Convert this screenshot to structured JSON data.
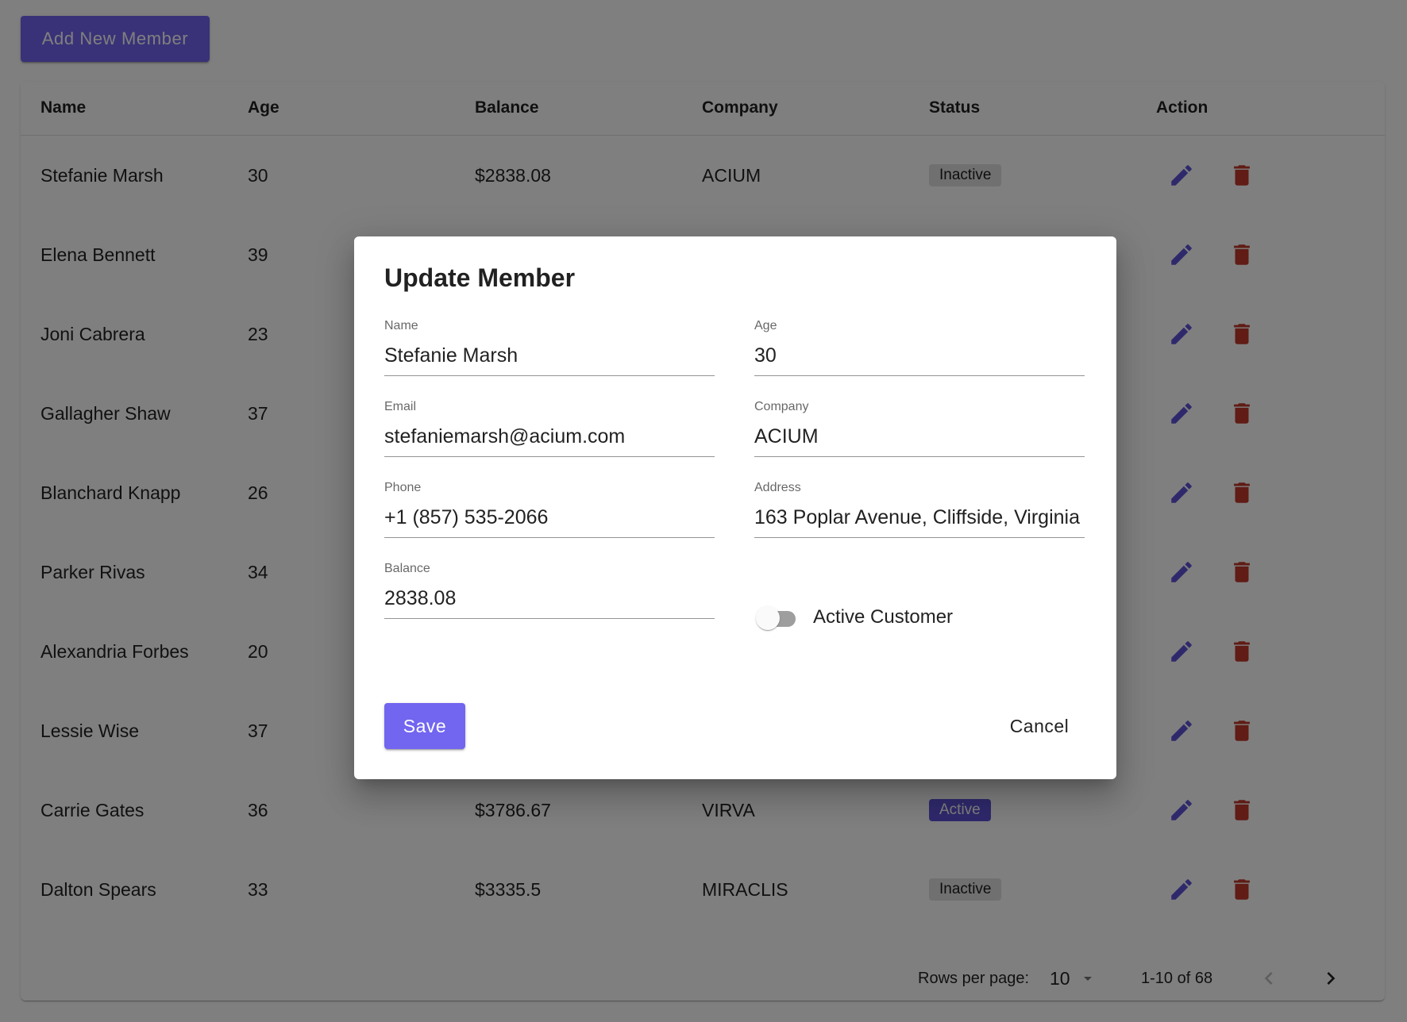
{
  "toolbar": {
    "add_label": "Add New Member"
  },
  "table": {
    "columns": [
      "Name",
      "Age",
      "Balance",
      "Company",
      "Status",
      "Action"
    ],
    "rows": [
      {
        "name": "Stefanie Marsh",
        "age": "30",
        "balance": "$2838.08",
        "company": "ACIUM",
        "status": "Inactive"
      },
      {
        "name": "Elena Bennett",
        "age": "39",
        "balance": "",
        "company": "",
        "status": ""
      },
      {
        "name": "Joni Cabrera",
        "age": "23",
        "balance": "",
        "company": "",
        "status": ""
      },
      {
        "name": "Gallagher Shaw",
        "age": "37",
        "balance": "",
        "company": "",
        "status": ""
      },
      {
        "name": "Blanchard Knapp",
        "age": "26",
        "balance": "",
        "company": "",
        "status": ""
      },
      {
        "name": "Parker Rivas",
        "age": "34",
        "balance": "",
        "company": "",
        "status": ""
      },
      {
        "name": "Alexandria Forbes",
        "age": "20",
        "balance": "",
        "company": "",
        "status": ""
      },
      {
        "name": "Lessie Wise",
        "age": "37",
        "balance": "",
        "company": "",
        "status": ""
      },
      {
        "name": "Carrie Gates",
        "age": "36",
        "balance": "$3786.67",
        "company": "VIRVA",
        "status": "Active"
      },
      {
        "name": "Dalton Spears",
        "age": "33",
        "balance": "$3335.5",
        "company": "MIRACLIS",
        "status": "Inactive"
      }
    ]
  },
  "pagination": {
    "rows_label": "Rows per page:",
    "rows_value": "10",
    "range": "1-10 of 68"
  },
  "dialog": {
    "title": "Update Member",
    "fields": {
      "name": {
        "label": "Name",
        "value": "Stefanie Marsh"
      },
      "age": {
        "label": "Age",
        "value": "30"
      },
      "email": {
        "label": "Email",
        "value": "stefaniemarsh@acium.com"
      },
      "company": {
        "label": "Company",
        "value": "ACIUM"
      },
      "phone": {
        "label": "Phone",
        "value": "+1 (857) 535-2066"
      },
      "address": {
        "label": "Address",
        "value": "163 Poplar Avenue, Cliffside, Virginia"
      },
      "balance": {
        "label": "Balance",
        "value": "2838.08"
      }
    },
    "active_label": "Active Customer",
    "active": false,
    "save_label": "Save",
    "cancel_label": "Cancel"
  },
  "colors": {
    "primary": "#7265f0",
    "edit_icon": "#5e53d8",
    "delete_icon": "#c0392b",
    "active_badge": "#5e53d8",
    "inactive_badge": "#e0e0e0"
  },
  "icons": {
    "edit": "pencil-icon",
    "delete": "trash-icon",
    "dropdown": "caret-down-icon",
    "prev": "chevron-left-icon",
    "next": "chevron-right-icon"
  }
}
